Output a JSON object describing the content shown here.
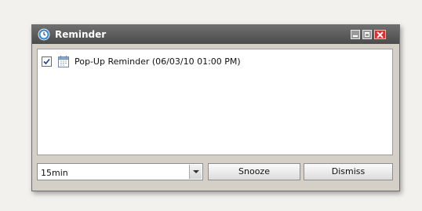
{
  "window": {
    "title": "Reminder",
    "icon": "reminder-app-icon"
  },
  "titlebar_buttons": {
    "minimize_icon": "minimize-icon",
    "maximize_icon": "maximize-icon",
    "close_icon": "close-icon"
  },
  "reminders": [
    {
      "checked": true,
      "icon": "calendar-icon",
      "text": "Pop-Up Reminder (06/03/10 01:00 PM)"
    }
  ],
  "snooze": {
    "selected": "15min"
  },
  "buttons": {
    "snooze_label": "Snooze",
    "dismiss_label": "Dismiss"
  },
  "colors": {
    "titlebar": "#5a5a5a",
    "close_button": "#d8322a",
    "window_bg": "#d4d0c8"
  }
}
